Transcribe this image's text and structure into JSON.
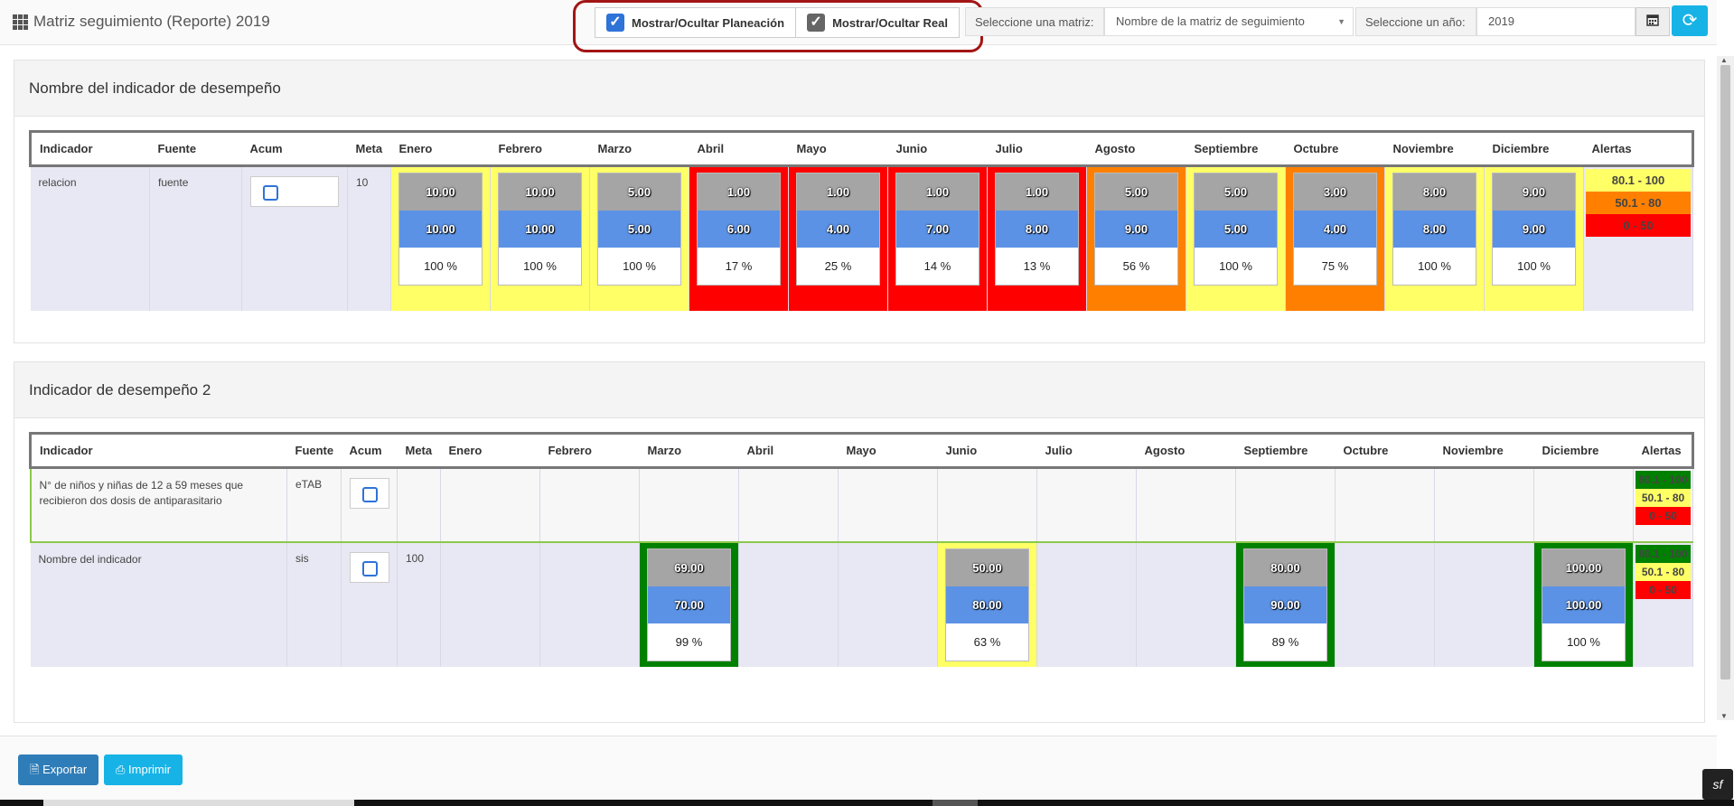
{
  "header": {
    "title": "Matriz seguimiento (Reporte) 2019",
    "toggle_planeacion": "Mostrar/Ocultar Planeación",
    "toggle_real": "Mostrar/Ocultar Real",
    "matrix_label": "Seleccione una matriz:",
    "matrix_value": "Nombre de la matriz de seguimiento",
    "year_label": "Seleccione un año:",
    "year_value": "2019"
  },
  "panel1": {
    "title": "Nombre del indicador de desempeño",
    "headers": [
      "Indicador",
      "Fuente",
      "Acum",
      "Meta",
      "Enero",
      "Febrero",
      "Marzo",
      "Abril",
      "Mayo",
      "Junio",
      "Julio",
      "Agosto",
      "Septiembre",
      "Octubre",
      "Noviembre",
      "Diciembre",
      "Alertas"
    ],
    "row": {
      "indicador": "relacion",
      "fuente": "fuente",
      "meta": "10",
      "months": [
        {
          "plan": "10.00",
          "real": "10.00",
          "pct": "100 %",
          "color": "#ffff66"
        },
        {
          "plan": "10.00",
          "real": "10.00",
          "pct": "100 %",
          "color": "#ffff66"
        },
        {
          "plan": "5.00",
          "real": "5.00",
          "pct": "100 %",
          "color": "#ffff66"
        },
        {
          "plan": "1.00",
          "real": "6.00",
          "pct": "17 %",
          "color": "#ff0000"
        },
        {
          "plan": "1.00",
          "real": "4.00",
          "pct": "25 %",
          "color": "#ff0000"
        },
        {
          "plan": "1.00",
          "real": "7.00",
          "pct": "14 %",
          "color": "#ff0000"
        },
        {
          "plan": "1.00",
          "real": "8.00",
          "pct": "13 %",
          "color": "#ff0000"
        },
        {
          "plan": "5.00",
          "real": "9.00",
          "pct": "56 %",
          "color": "#ff8000"
        },
        {
          "plan": "5.00",
          "real": "5.00",
          "pct": "100 %",
          "color": "#ffff66"
        },
        {
          "plan": "3.00",
          "real": "4.00",
          "pct": "75 %",
          "color": "#ff8000"
        },
        {
          "plan": "8.00",
          "real": "8.00",
          "pct": "100 %",
          "color": "#ffff66"
        },
        {
          "plan": "9.00",
          "real": "9.00",
          "pct": "100 %",
          "color": "#ffff66"
        }
      ],
      "alerts": [
        {
          "label": "80.1 - 100",
          "color": "#ffff66"
        },
        {
          "label": "50.1 - 80",
          "color": "#ff8000"
        },
        {
          "label": "0 - 50",
          "color": "#ff0000"
        }
      ]
    }
  },
  "panel2": {
    "title": "Indicador de desempeño 2",
    "headers": [
      "Indicador",
      "Fuente",
      "Acum",
      "Meta",
      "Enero",
      "Febrero",
      "Marzo",
      "Abril",
      "Mayo",
      "Junio",
      "Julio",
      "Agosto",
      "Septiembre",
      "Octubre",
      "Noviembre",
      "Diciembre",
      "Alertas"
    ],
    "rows": [
      {
        "indicador": "N° de niños y niñas de 12 a 59 meses que recibieron dos dosis de antiparasitario",
        "fuente": "eTAB",
        "meta": "",
        "alerts": [
          {
            "label": "80.1 - 100",
            "color": "#008000"
          },
          {
            "label": "50.1 - 80",
            "color": "#ffff66"
          },
          {
            "label": "0 - 50",
            "color": "#ff0000"
          }
        ]
      },
      {
        "indicador": "Nombre del indicador",
        "fuente": "sis",
        "meta": "100",
        "months": {
          "Marzo": {
            "plan": "69.00",
            "real": "70.00",
            "pct": "99 %",
            "color": "#008000"
          },
          "Junio": {
            "plan": "50.00",
            "real": "80.00",
            "pct": "63 %",
            "color": "#ffff66"
          },
          "Septiembre": {
            "plan": "80.00",
            "real": "90.00",
            "pct": "89 %",
            "color": "#008000"
          },
          "Diciembre": {
            "plan": "100.00",
            "real": "100.00",
            "pct": "100 %",
            "color": "#008000"
          }
        },
        "alerts": [
          {
            "label": "80.1 - 100",
            "color": "#008000"
          },
          {
            "label": "50.1 - 80",
            "color": "#ffff66"
          },
          {
            "label": "0 - 50",
            "color": "#ff0000"
          }
        ]
      }
    ]
  },
  "footer": {
    "export_label": "Exportar",
    "print_label": "Imprimir"
  },
  "icons": {
    "menu": "grid-icon",
    "calendar": "calendar-icon",
    "refresh": "refresh-icon",
    "export": "file-icon",
    "print": "print-icon",
    "symfony": "symfony-icon"
  }
}
